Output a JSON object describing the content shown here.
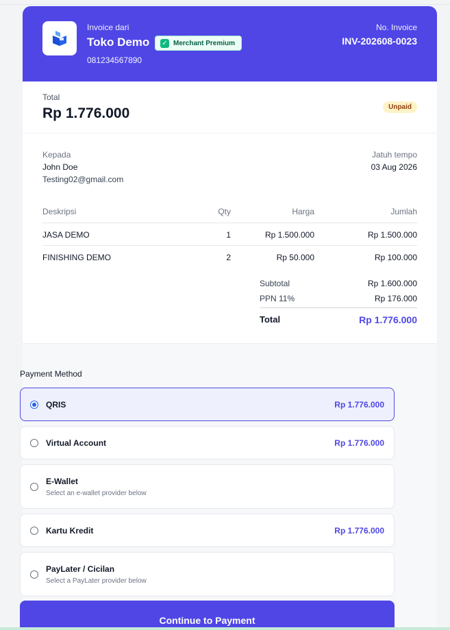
{
  "header": {
    "from_label": "Invoice dari",
    "merchant_name": "Toko Demo",
    "merchant_badge": "Merchant Premium",
    "phone": "081234567890",
    "invoice_label": "No. Invoice",
    "invoice_number": "INV-202608-0023",
    "brand_color": "#4f46e5"
  },
  "summary": {
    "total_label": "Total",
    "total_amount": "Rp 1.776.000",
    "status": "Unpaid"
  },
  "recipient": {
    "to_label": "Kepada",
    "name": "John Doe",
    "email": "Testing02@gmail.com",
    "due_label": "Jatuh tempo",
    "due_date": "03 Aug 2026"
  },
  "items": {
    "headers": [
      "Deskripsi",
      "Qty",
      "Harga",
      "Jumlah"
    ],
    "rows": [
      [
        "JASA DEMO",
        "1",
        "Rp 1.500.000",
        "Rp 1.500.000"
      ],
      [
        "FINISHING DEMO",
        "2",
        "Rp 50.000",
        "Rp 100.000"
      ]
    ]
  },
  "totals": {
    "subtotal_label": "Subtotal",
    "subtotal": "Rp 1.600.000",
    "tax_label": "PPN 11%",
    "tax": "Rp 176.000",
    "total_label": "Total",
    "total": "Rp 1.776.000"
  },
  "payment": {
    "title": "Payment Method",
    "options": [
      {
        "name": "QRIS",
        "price": "Rp 1.776.000",
        "selected": true
      },
      {
        "name": "Virtual Account",
        "price": "Rp 1.776.000",
        "selected": false
      },
      {
        "name": "E-Wallet",
        "sub": "Select an e-wallet provider below",
        "selected": false
      },
      {
        "name": "Kartu Kredit",
        "price": "Rp 1.776.000",
        "selected": false
      },
      {
        "name": "PayLater / Cicilan",
        "sub": "Select a PayLater provider below",
        "selected": false
      }
    ],
    "cta_label": "Continue to Payment"
  },
  "icons": {
    "logo": "store-logo-icon",
    "badge_check": "check-icon"
  }
}
